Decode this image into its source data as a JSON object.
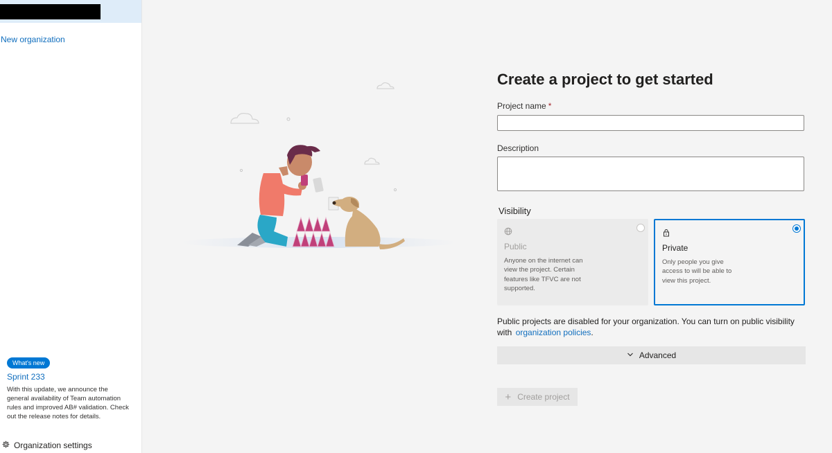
{
  "sidebar": {
    "new_org_label": "New organization",
    "whats_new_badge": "What's new",
    "sprint_title": "Sprint 233",
    "sprint_description": "With this update, we announce the general availability of Team automation rules and improved AB# validation. Check out the release notes for details.",
    "settings_label": "Organization settings",
    "settings_icon": "gear-icon"
  },
  "form": {
    "title": "Create a project to get started",
    "name_label": "Project name",
    "name_required_marker": "*",
    "name_value": "",
    "description_label": "Description",
    "description_value": "",
    "visibility_label": "Visibility",
    "visibility_options": [
      {
        "title": "Public",
        "icon": "globe-icon",
        "description": "Anyone on the internet can view the project. Certain features like TFVC are not supported.",
        "selected": false,
        "disabled": true
      },
      {
        "title": "Private",
        "icon": "lock-icon",
        "description": "Only people you give access to will be able to view this project.",
        "selected": true,
        "disabled": false
      }
    ],
    "notice_text": "Public projects are disabled for your organization. You can turn on public visibility with",
    "notice_link": "organization policies",
    "notice_end": ".",
    "advanced_label": "Advanced",
    "create_label": "Create project",
    "create_icon": "plus-icon"
  },
  "colors": {
    "accent": "#0078d4",
    "link": "#106ebe",
    "background": "#f4f4f4",
    "required": "#a4262c"
  }
}
